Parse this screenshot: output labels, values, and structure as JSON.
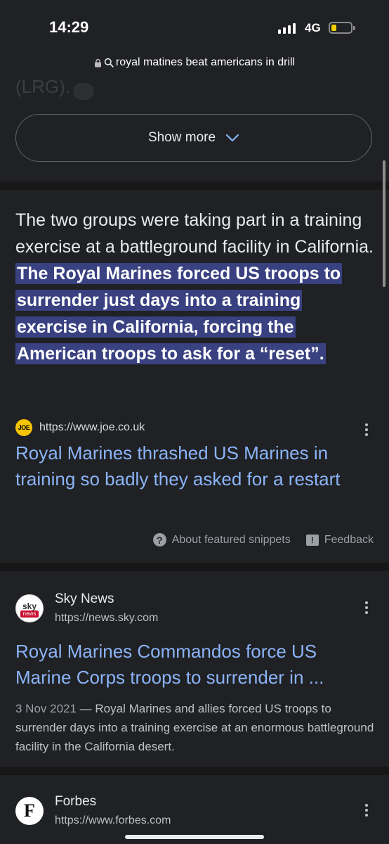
{
  "status_bar": {
    "time": "14:29",
    "network": "4G"
  },
  "url_bar": {
    "text": "royal matines beat americans in drill"
  },
  "cut_off_text": "(LRG).",
  "show_more": {
    "label": "Show more"
  },
  "featured_snippet": {
    "text_plain": "The two groups were taking part in a training exercise at a battleground facility in California. ",
    "text_highlight": "The Royal Marines forced US troops to surrender just days into a training exercise in California, forcing the American troops to ask for a “reset”.",
    "source_icon": "JOE",
    "source_url": "https://www.joe.co.uk",
    "title": "Royal Marines thrashed US Marines in training so badly they asked for a restart",
    "about_label": "About featured snippets",
    "feedback_label": "Feedback"
  },
  "results": [
    {
      "site_name": "Sky News",
      "url": "https://news.sky.com",
      "logo_top": "sky",
      "logo_bottom": "news",
      "title": "Royal Marines Commandos force US Marine Corps troops to surrender in ...",
      "date": "3 Nov 2021",
      "description": " — Royal Marines and allies forced US troops to surrender days into a training exercise at an enormous battleground facility in the California desert."
    },
    {
      "site_name": "Forbes",
      "url": "https://www.forbes.com",
      "logo": "F"
    }
  ],
  "colors": {
    "background": "#202124",
    "link": "#8ab4f8",
    "highlight": "#394181",
    "separator": "#171717"
  }
}
